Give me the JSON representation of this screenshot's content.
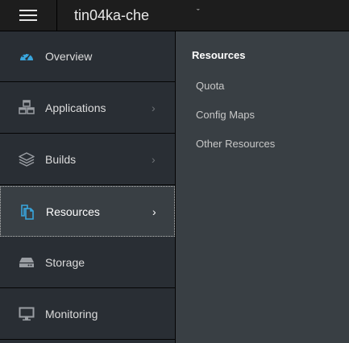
{
  "topbar": {
    "menu_icon": "hamburger-menu-icon",
    "project_name": "tin04ka-che",
    "project_caret": "ˇ"
  },
  "sidebar": {
    "items": [
      {
        "label": "Overview",
        "icon": "dashboard-gauge-icon",
        "chevron": ""
      },
      {
        "label": "Applications",
        "icon": "cubes-icon",
        "chevron": "›"
      },
      {
        "label": "Builds",
        "icon": "layers-icon",
        "chevron": "›"
      },
      {
        "label": "Resources",
        "icon": "copy-files-icon",
        "chevron": "›",
        "active": true
      },
      {
        "label": "Storage",
        "icon": "hard-drive-icon",
        "chevron": ""
      },
      {
        "label": "Monitoring",
        "icon": "monitor-icon",
        "chevron": ""
      }
    ]
  },
  "secondary": {
    "title": "Resources",
    "links": [
      "Quota",
      "Config Maps",
      "Other Resources"
    ]
  },
  "colors": {
    "accent": "#39a5dc",
    "sidebar_bg": "#292e34",
    "active_bg": "#393f44",
    "topbar_bg": "#1d1d1d"
  }
}
